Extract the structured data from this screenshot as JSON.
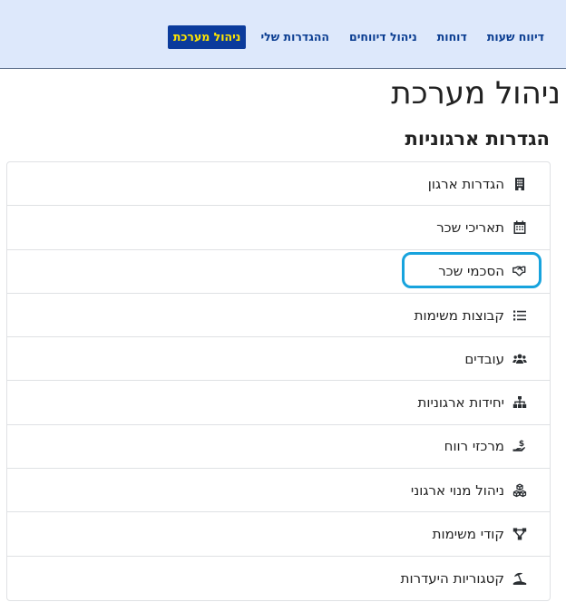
{
  "nav": {
    "items": [
      {
        "label": "דיווח שעות",
        "active": false
      },
      {
        "label": "דוחות",
        "active": false
      },
      {
        "label": "ניהול דיווחים",
        "active": false
      },
      {
        "label": "ההגדרות שלי",
        "active": false
      },
      {
        "label": "ניהול מערכת",
        "active": true
      }
    ]
  },
  "colors": {
    "topbar_bg": "#dde8fb",
    "nav_text": "#0a3d91",
    "active_bg": "#0b3b9c",
    "active_text": "#ffe600",
    "highlight": "#17a3dd"
  },
  "page": {
    "title": "ניהול מערכת",
    "section_title": "הגדרות ארגוניות"
  },
  "settings_list": {
    "items": [
      {
        "label": "הגדרות ארגון",
        "icon": "building-icon"
      },
      {
        "label": "תאריכי שכר",
        "icon": "calendar-icon"
      },
      {
        "label": "הסכמי שכר",
        "icon": "handshake-icon",
        "highlighted": true
      },
      {
        "label": "קבוצות משימות",
        "icon": "list-icon"
      },
      {
        "label": "עובדים",
        "icon": "users-icon"
      },
      {
        "label": "יחידות ארגוניות",
        "icon": "sitemap-icon"
      },
      {
        "label": "מרכזי רווח",
        "icon": "hand-dollar-icon"
      },
      {
        "label": "ניהול מנוי ארגוני",
        "icon": "cubes-icon"
      },
      {
        "label": "קודי משימות",
        "icon": "project-diagram-icon"
      },
      {
        "label": "קטגוריות היעדרות",
        "icon": "umbrella-beach-icon"
      }
    ]
  }
}
